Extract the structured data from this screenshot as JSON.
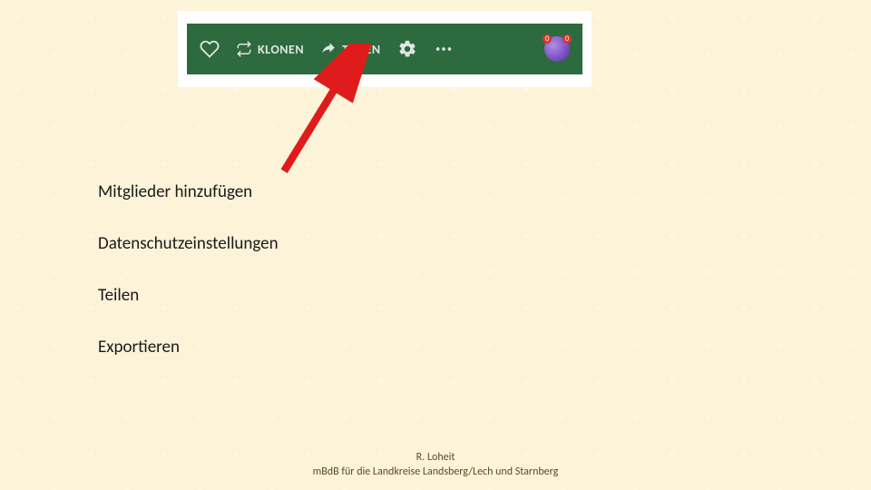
{
  "toolbar": {
    "clone_label": "KLONEN",
    "share_label": "TEILEN"
  },
  "menu": {
    "items": [
      "Mitglieder hinzufügen",
      "Datenschutzeinstellungen",
      "Teilen",
      "Exportieren"
    ]
  },
  "footer": {
    "line1": "R. Loheit",
    "line2": "mBdB für die Landkreise Landsberg/Lech und Starnberg"
  }
}
